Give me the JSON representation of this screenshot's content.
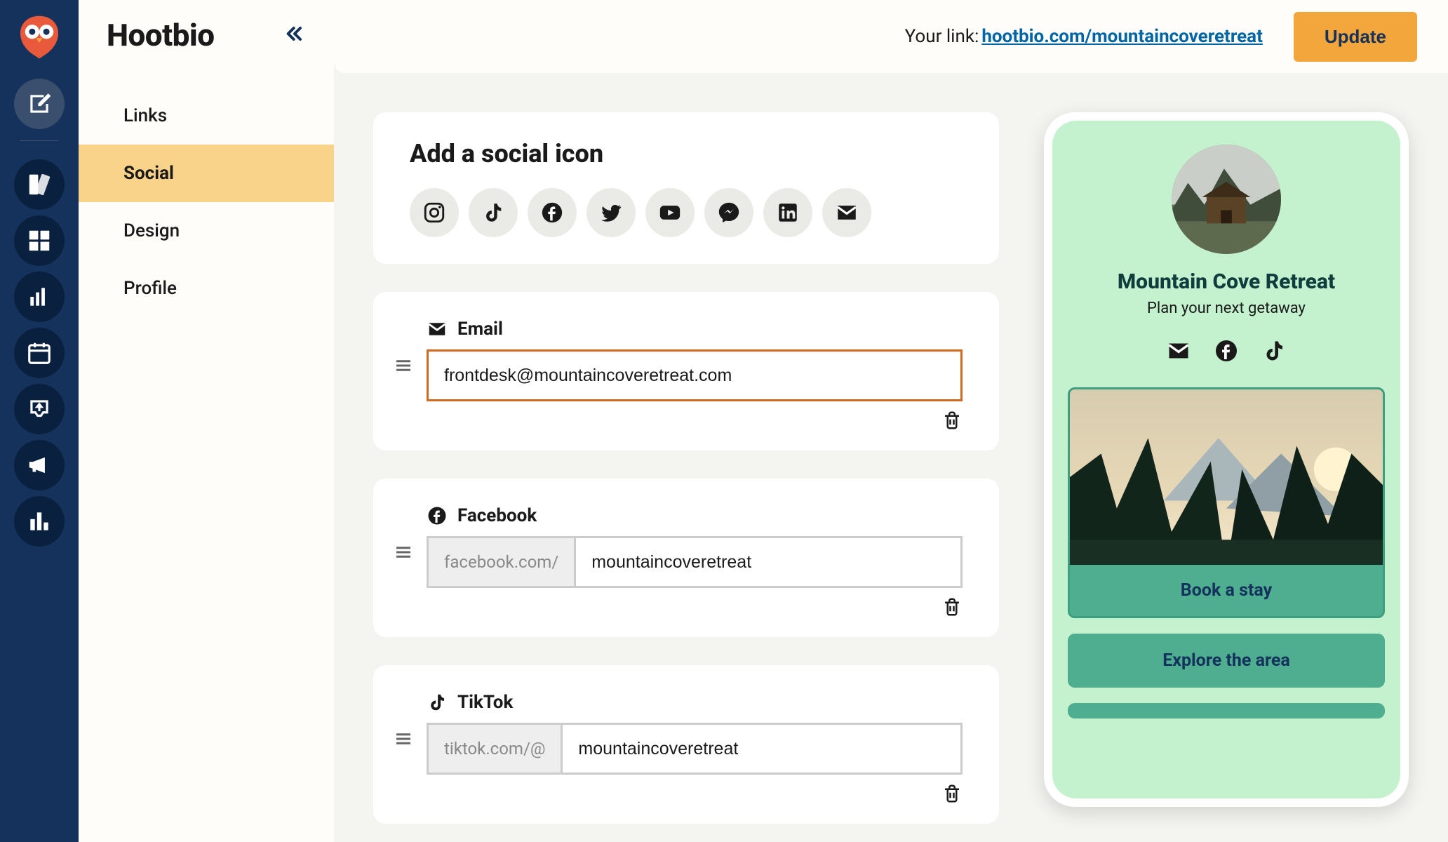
{
  "app": {
    "name": "Hootbio"
  },
  "topbar": {
    "your_link_label": "Your link:",
    "your_link_url": "hootbio.com/mountaincoveretreat",
    "update_label": "Update"
  },
  "sidebar": {
    "items": [
      {
        "label": "Links",
        "active": false
      },
      {
        "label": "Social",
        "active": true
      },
      {
        "label": "Design",
        "active": false
      },
      {
        "label": "Profile",
        "active": false
      }
    ]
  },
  "editor": {
    "add_social_heading": "Add a social icon",
    "available_icons": [
      "instagram",
      "tiktok",
      "facebook",
      "twitter",
      "youtube",
      "messenger",
      "linkedin",
      "email"
    ],
    "entries": [
      {
        "network": "Email",
        "prefix": "",
        "value": "frontdesk@mountaincoveretreat.com",
        "highlighted": true
      },
      {
        "network": "Facebook",
        "prefix": "facebook.com/",
        "value": "mountaincoveretreat",
        "highlighted": false
      },
      {
        "network": "TikTok",
        "prefix": "tiktok.com/@",
        "value": "mountaincoveretreat",
        "highlighted": false
      }
    ]
  },
  "preview": {
    "title": "Mountain Cove Retreat",
    "subtitle": "Plan your next getaway",
    "social_icons": [
      "email",
      "facebook",
      "tiktok"
    ],
    "links": [
      {
        "label": "Book a stay",
        "has_image": true
      },
      {
        "label": "Explore the area",
        "has_image": false
      }
    ]
  }
}
